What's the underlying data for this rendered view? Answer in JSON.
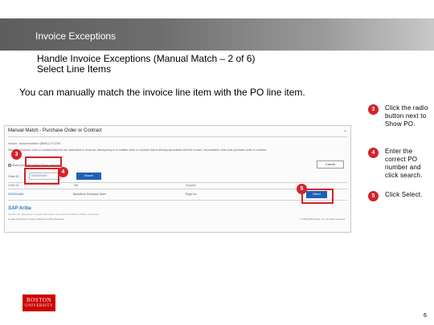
{
  "header": {
    "title": "Invoice Exceptions"
  },
  "heading": {
    "line1": "Handle Invoice Exceptions (Manual Match – 2 of 6)",
    "line2": " Select Line Items"
  },
  "intro": "You can manually match the invoice line item with the PO line item.",
  "screenshot": {
    "title": "Manual Match - Purchase Order or Contract",
    "close": "×",
    "info1": "Invoice: 'Accommodation (BMAC) 071239'",
    "info2": "Select a purchase order or contract that line are authorized to more tax discrepancy to a suitable order or contract that is already associated with the invoice, reconciliation, then that purchase order or contract",
    "cancel_label": "Cancel",
    "radio_label": "Show purchase orders    Show contracts",
    "order_label": "Order ID",
    "order_value": "6500004660",
    "search_label": "Search",
    "col_order": "Order ID",
    "col_title": "Title",
    "col_supplier": "Supplier",
    "row_order": "6500004660",
    "row_title": "BackDesk Desktop# 1Item",
    "row_supplier": "Pppp Inc",
    "select_label": "Select",
    "logo": "SAP Ariba",
    "footer1": "Session ID: aribaserver   Contact Information   Terms and Conditions   Privacy Statement",
    "footer2": "Cookie Disclosure   Privacy Statement   Ariba Business",
    "copyright": "© 1996-2019 Ariba, Inc. All rights reserved."
  },
  "badges": {
    "b3": "3",
    "b4": "4",
    "b5": "5"
  },
  "steps": [
    {
      "num": "3",
      "text": "Click the radio button next to Show PO."
    },
    {
      "num": "4",
      "text": "Enter the correct PO number and click search."
    },
    {
      "num": "5",
      "text": "Click Select."
    }
  ],
  "logo": {
    "line1": "BOSTON",
    "line2": "UNIVERSITY"
  },
  "page_number": "6",
  "colors": {
    "highlight": "#d2232a",
    "button_blue": "#1f5fb6",
    "bu_red": "#cc0000"
  }
}
